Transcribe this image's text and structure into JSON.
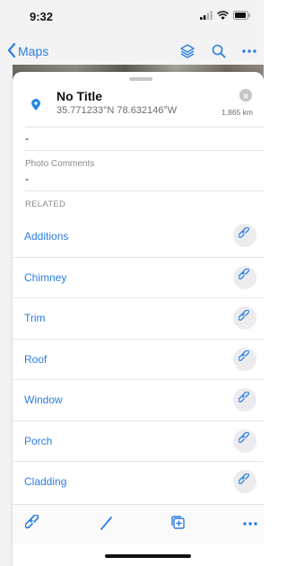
{
  "status": {
    "time": "9:32"
  },
  "nav": {
    "back_label": "Maps"
  },
  "feature": {
    "title": "No Title",
    "coordinates": "35.771233°N  78.632146°W",
    "distance": "1,865 km"
  },
  "fields": {
    "previous_value": "-",
    "photo_comments_label": "Photo Comments",
    "photo_comments_value": "-"
  },
  "related": {
    "header": "RELATED",
    "items": [
      "Additions",
      "Chimney",
      "Trim",
      "Roof",
      "Window",
      "Porch",
      "Cladding"
    ]
  },
  "colors": {
    "accent": "#2b7de0",
    "pin": "#1e88e5"
  },
  "icons": {
    "nav": [
      "chevron-left-icon",
      "layers-icon",
      "search-icon",
      "more-icon"
    ],
    "toolbar": [
      "link-icon",
      "pencil-icon",
      "add-copy-icon",
      "more-icon"
    ]
  }
}
